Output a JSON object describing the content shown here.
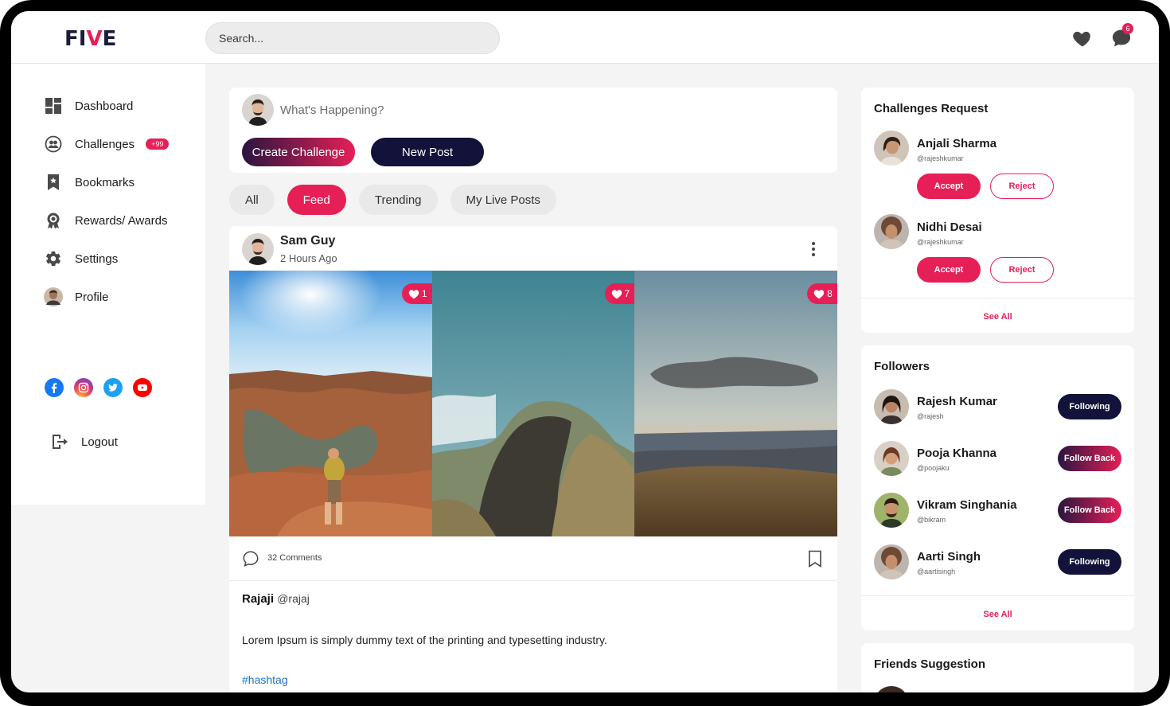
{
  "brand": {
    "logo_prefix": "FI",
    "logo_v": "V",
    "logo_suffix": "E"
  },
  "search": {
    "placeholder": "Search..."
  },
  "header": {
    "notification_count": "6",
    "icons": [
      "heart-icon",
      "chat-icon"
    ]
  },
  "sidebar": {
    "items": [
      {
        "label": "Dashboard",
        "icon": "dashboard-icon"
      },
      {
        "label": "Challenges",
        "icon": "challenges-icon",
        "badge": "+99"
      },
      {
        "label": "Bookmarks",
        "icon": "bookmark-icon"
      },
      {
        "label": "Rewards/ Awards",
        "icon": "award-icon"
      },
      {
        "label": "Settings",
        "icon": "gear-icon"
      },
      {
        "label": "Profile",
        "icon": "avatar"
      }
    ],
    "socials": [
      "facebook",
      "instagram",
      "twitter",
      "youtube"
    ],
    "logout_label": "Logout"
  },
  "composer": {
    "placeholder": "What's Happening?",
    "create_label": "Create Challenge",
    "new_post_label": "New Post"
  },
  "tabs": [
    {
      "label": "All",
      "active": false
    },
    {
      "label": "Feed",
      "active": true
    },
    {
      "label": "Trending",
      "active": false
    },
    {
      "label": "My Live Posts",
      "active": false
    }
  ],
  "post": {
    "author": "Sam Guy",
    "time": "2 Hours Ago",
    "photos": [
      {
        "likes": "1"
      },
      {
        "likes": "7"
      },
      {
        "likes": "8"
      }
    ],
    "comments": "32 Comments",
    "caption_user": "Rajaji",
    "caption_handle": "@rajaj",
    "caption_text": "Lorem Ipsum is simply dummy text of the printing and typesetting industry.",
    "hashtag": "#hashtag"
  },
  "requests": {
    "title": "Challenges Request",
    "people": [
      {
        "name": "Anjali Sharma",
        "handle": "@rajeshkumar"
      },
      {
        "name": "Nidhi Desai",
        "handle": "@rajeshkumar"
      }
    ],
    "accept_label": "Accept",
    "reject_label": "Reject",
    "see_all": "See All"
  },
  "followers": {
    "title": "Followers",
    "people": [
      {
        "name": "Rajesh Kumar",
        "handle": "@rajesh",
        "action": "Following"
      },
      {
        "name": "Pooja Khanna",
        "handle": "@poojaku",
        "action": "Follow Back"
      },
      {
        "name": "Vikram Singhania",
        "handle": "@bikram",
        "action": "Follow Back"
      },
      {
        "name": "Aarti Singh",
        "handle": "@aartisingh",
        "action": "Following"
      }
    ],
    "see_all": "See All"
  },
  "suggestions": {
    "title": "Friends Suggestion"
  },
  "colors": {
    "accent": "#e61f57",
    "navy": "#13123a",
    "link": "#1a73c8"
  }
}
